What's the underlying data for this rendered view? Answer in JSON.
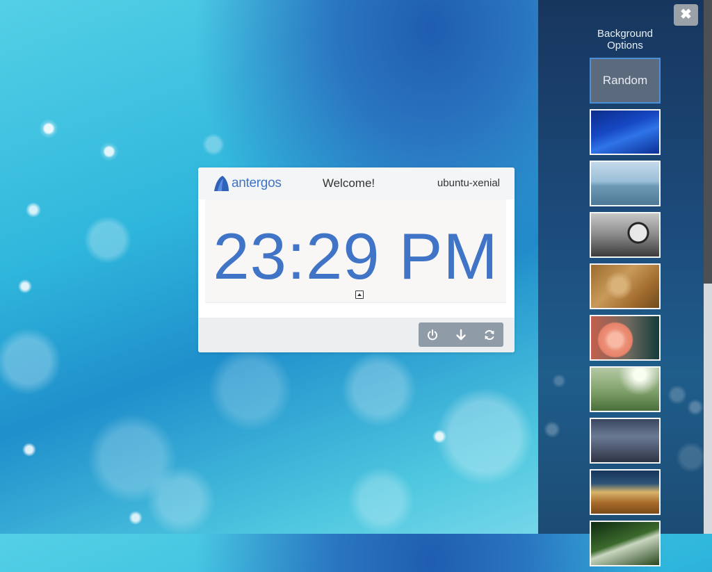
{
  "sidebar": {
    "title": "Background Options",
    "random_label": "Random",
    "thumbnails": [
      {
        "icon": "blue-abstract-wallpaper"
      },
      {
        "icon": "lake-pier-wallpaper"
      },
      {
        "icon": "clock-wallpaper"
      },
      {
        "icon": "dry-grass-wallpaper"
      },
      {
        "icon": "pink-flower-wallpaper"
      },
      {
        "icon": "sunny-meadow-wallpaper"
      },
      {
        "icon": "building-interior-wallpaper"
      },
      {
        "icon": "wheat-field-wallpaper"
      },
      {
        "icon": "leaf-droplets-wallpaper"
      }
    ]
  },
  "card": {
    "logo_text": "antergos",
    "welcome": "Welcome!",
    "hostname": "ubuntu-xenial",
    "clock": "23:29 PM"
  },
  "power_buttons": [
    "power-icon",
    "suspend-icon",
    "restart-icon"
  ],
  "colors": {
    "accent": "#3f74c6",
    "sidebar_bg": "#1c4a7a",
    "button_group": "#8f9ba6"
  }
}
